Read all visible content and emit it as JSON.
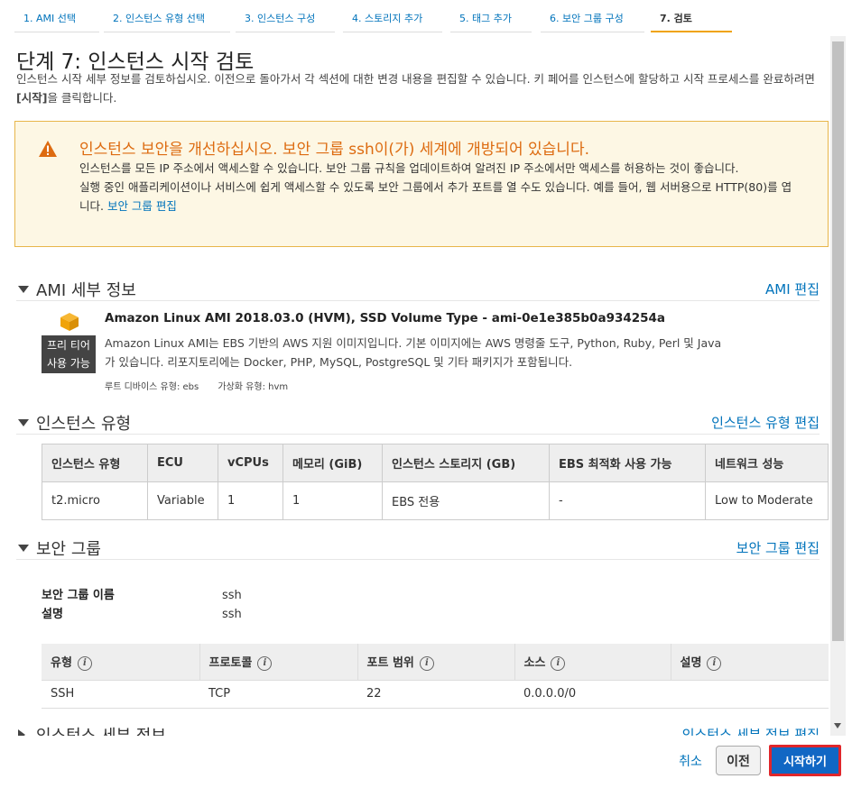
{
  "tabs": [
    {
      "label": "1. AMI 선택"
    },
    {
      "label": "2. 인스턴스 유형 선택"
    },
    {
      "label": "3. 인스턴스 구성"
    },
    {
      "label": "4. 스토리지 추가"
    },
    {
      "label": "5. 태그 추가"
    },
    {
      "label": "6. 보안 그룹 구성"
    },
    {
      "label": "7. 검토"
    }
  ],
  "active_tab": "7. 검토",
  "page": {
    "title": "단계 7: 인스턴스 시작 검토",
    "intro_before": "인스턴스 시작 세부 정보를 검토하십시오. 이전으로 돌아가서 각 섹션에 대한 변경 내용을 편집할 수 있습니다. 키 페어를 인스턴스에 할당하고 시작 프로세스를 완료하려면 ",
    "intro_bold": "[시작]",
    "intro_after": "을 클릭합니다."
  },
  "warning": {
    "icon": "warning-triangle-icon",
    "title": "인스턴스 보안을 개선하십시오. 보안 그룹 ssh이(가) 세계에 개방되어 있습니다.",
    "line1": "인스턴스를 모든 IP 주소에서 액세스할 수 있습니다. 보안 그룹 규칙을 업데이트하여 알려진 IP 주소에서만 액세스를 허용하는 것이 좋습니다.",
    "line2": "실행 중인 애플리케이션이나 서비스에 쉽게 액세스할 수 있도록 보안 그룹에서 추가 포트를 열 수도 있습니다. 예를 들어, 웹 서버용으로 HTTP(80)를 엽니다. ",
    "link": "보안 그룹 편집"
  },
  "ami": {
    "section_title": "AMI 세부 정보",
    "edit_link": "AMI 편집",
    "icon": "amazon-box-icon",
    "badge_line1": "프리 티어",
    "badge_line2": "사용 가능",
    "name": "Amazon Linux AMI 2018.03.0 (HVM), SSD Volume Type - ami-0e1e385b0a934254a",
    "description": "Amazon Linux AMI는 EBS 기반의 AWS 지원 이미지입니다. 기본 이미지에는 AWS 명령줄 도구, Python, Ruby, Perl 및 Java가 있습니다. 리포지토리에는 Docker, PHP, MySQL, PostgreSQL 및 기타 패키지가 포함됩니다.",
    "root_device": "루트 디바이스 유형: ebs",
    "virtualization": "가상화 유형: hvm"
  },
  "instance_type": {
    "section_title": "인스턴스 유형",
    "edit_link": "인스턴스 유형 편집",
    "columns": [
      "인스턴스 유형",
      "ECU",
      "vCPUs",
      "메모리 (GiB)",
      "인스턴스 스토리지 (GB)",
      "EBS 최적화 사용 가능",
      "네트워크 성능"
    ],
    "rows": [
      [
        "t2.micro",
        "Variable",
        "1",
        "1",
        "EBS 전용",
        "-",
        "Low to Moderate"
      ]
    ]
  },
  "security_group": {
    "section_title": "보안 그룹",
    "edit_link": "보안 그룹 편집",
    "name_label": "보안 그룹 이름",
    "name_value": "ssh",
    "desc_label": "설명",
    "desc_value": "ssh",
    "columns": [
      "유형",
      "프로토콜",
      "포트 범위",
      "소스",
      "설명"
    ],
    "info_glyph": "i",
    "rows": [
      [
        "SSH",
        "TCP",
        "22",
        "0.0.0.0/0",
        ""
      ]
    ]
  },
  "instance_details": {
    "section_title": "인스턴스 세부 정보",
    "edit_link": "인스턴스 세부 정보 편집"
  },
  "footer": {
    "cancel": "취소",
    "previous": "이전",
    "launch": "시작하기"
  },
  "colors": {
    "link": "#0073bb",
    "warning_title": "#dd6b10",
    "warning_bg": "#fdf7e4",
    "launch_button": "#1167c4",
    "launch_highlight": "#e0262b"
  }
}
